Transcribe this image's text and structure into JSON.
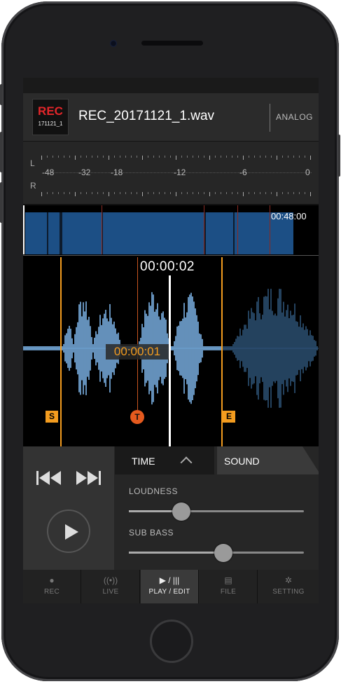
{
  "header": {
    "logo_top": "REC",
    "logo_bottom": "171121_1",
    "filename": "REC_20171121_1.wav",
    "input_mode": "ANALOG"
  },
  "meter": {
    "left_label": "L",
    "right_label": "R",
    "scale": [
      "-48",
      "-32",
      "-18",
      "-12",
      "-6",
      "0"
    ]
  },
  "overview": {
    "total_time": "00:48:00"
  },
  "waveform": {
    "current_time": "00:00:02",
    "cursor_time": "00:00:01",
    "start_marker": "S",
    "end_marker": "E",
    "trim_marker": "T"
  },
  "tabs": {
    "time": "TIME",
    "sound": "SOUND"
  },
  "sound": {
    "loudness_label": "LOUDNESS",
    "loudness_level": 0.3,
    "subbass_label": "SUB BASS",
    "subbass_level": 0.54
  },
  "nav": [
    {
      "label": "REC",
      "icon": "record-icon"
    },
    {
      "label": "LIVE",
      "icon": "broadcast-icon"
    },
    {
      "label": "PLAY / EDIT",
      "icon": "play-pause-icon"
    },
    {
      "label": "FILE",
      "icon": "document-icon"
    },
    {
      "label": "SETTING",
      "icon": "gear-icon"
    }
  ],
  "colors": {
    "accent_orange": "#f39c1f",
    "wave_blue": "#7db5e8",
    "rec_red": "#e3262a"
  }
}
